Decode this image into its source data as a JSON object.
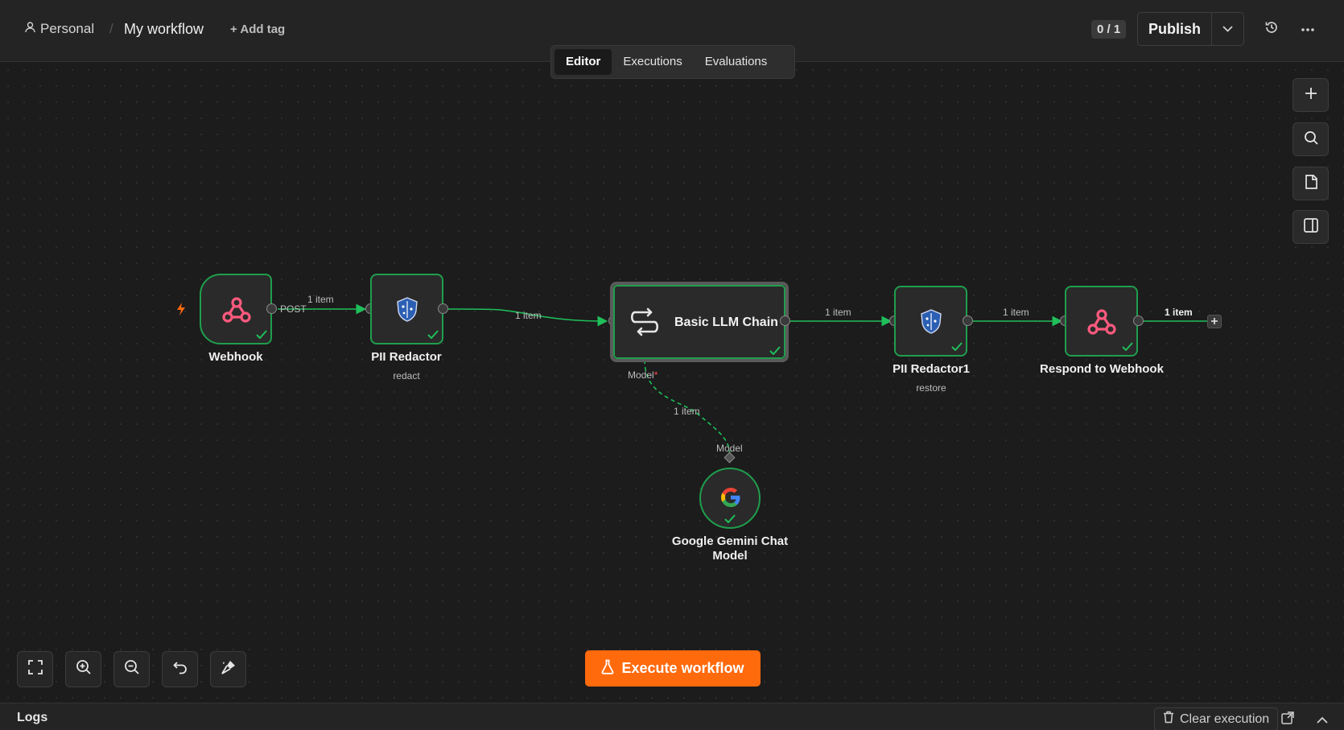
{
  "header": {
    "project": "Personal",
    "separator": "/",
    "workflow_title": "My workflow",
    "add_tag": "+ Add tag",
    "counter": "0 / 1",
    "publish_label": "Publish"
  },
  "tabs": [
    {
      "label": "Editor",
      "active": true
    },
    {
      "label": "Executions",
      "active": false
    },
    {
      "label": "Evaluations",
      "active": false
    }
  ],
  "nodes": {
    "webhook": {
      "title": "Webhook",
      "icon": "webhook-icon"
    },
    "pii1": {
      "title": "PII Redactor",
      "subtitle": "redact",
      "icon": "shield-icon"
    },
    "llm": {
      "title": "Basic LLM Chain",
      "icon": "chain-icon"
    },
    "pii2": {
      "title": "PII Redactor1",
      "subtitle": "restore",
      "icon": "shield-icon"
    },
    "respond": {
      "title": "Respond to Webhook",
      "icon": "webhook-icon"
    },
    "gemini": {
      "title_line1": "Google Gemini Chat",
      "title_line2": "Model",
      "icon": "google-icon"
    }
  },
  "edges": {
    "post": "POST",
    "webhook_to_pii": "1 item",
    "pii_to_llm": "1 item",
    "llm_to_pii2": "1 item",
    "pii2_to_respond": "1 item",
    "respond_out": "1 item",
    "model_edge": "1 item",
    "model_in_label": "Model",
    "model_in_required": "*",
    "model_out_label": "Model"
  },
  "toolbar": {
    "execute_label": "Execute workflow"
  },
  "logs": {
    "title": "Logs",
    "clear_label": "Clear execution"
  },
  "colors": {
    "accent": "#ff6a0d",
    "success": "#1f9e4d",
    "webhook": "#ff5a7e"
  }
}
